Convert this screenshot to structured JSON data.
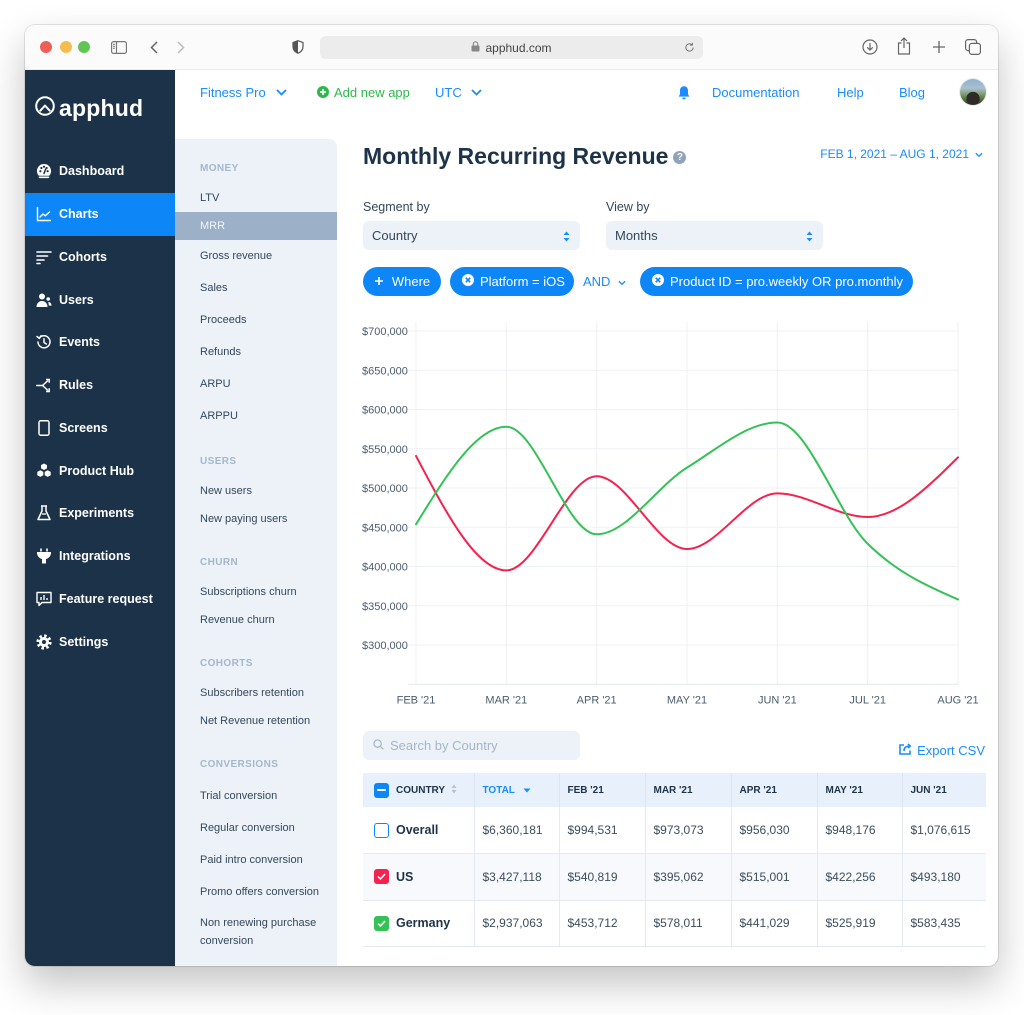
{
  "browser": {
    "url": "apphud.com"
  },
  "brand": {
    "name": "apphud"
  },
  "colors": {
    "accent": "#0d87f8",
    "link": "#1a8cff",
    "sidebar_bg": "#1c3249",
    "add_app": "#2db84c",
    "us": "#f5224f",
    "germany": "#34c156"
  },
  "sidebar": {
    "items": [
      {
        "label": "Dashboard",
        "icon": "dashboard-icon"
      },
      {
        "label": "Charts",
        "icon": "charts-icon",
        "active": true
      },
      {
        "label": "Cohorts",
        "icon": "cohorts-icon"
      },
      {
        "label": "Users",
        "icon": "users-icon"
      },
      {
        "label": "Events",
        "icon": "events-icon"
      },
      {
        "label": "Rules",
        "icon": "rules-icon"
      },
      {
        "label": "Screens",
        "icon": "screens-icon"
      },
      {
        "label": "Product Hub",
        "icon": "product-hub-icon"
      },
      {
        "label": "Experiments",
        "icon": "experiments-icon"
      },
      {
        "label": "Integrations",
        "icon": "integrations-icon"
      },
      {
        "label": "Feature request",
        "icon": "feature-request-icon"
      },
      {
        "label": "Settings",
        "icon": "settings-icon"
      }
    ]
  },
  "topnav": {
    "app_name": "Fitness Pro",
    "add_app_label": "Add new app",
    "timezone": "UTC",
    "links": {
      "documentation": "Documentation",
      "help": "Help",
      "blog": "Blog"
    }
  },
  "submenu": {
    "sections": [
      {
        "title": "MONEY",
        "items": [
          {
            "label": "LTV"
          },
          {
            "label": "MRR",
            "active": true
          },
          {
            "label": "Gross revenue"
          },
          {
            "label": "Sales"
          },
          {
            "label": "Proceeds"
          },
          {
            "label": "Refunds"
          },
          {
            "label": "ARPU"
          },
          {
            "label": "ARPPU"
          }
        ]
      },
      {
        "title": "USERS",
        "items": [
          {
            "label": "New users"
          },
          {
            "label": "New paying users"
          }
        ]
      },
      {
        "title": "CHURN",
        "items": [
          {
            "label": "Subscriptions churn"
          },
          {
            "label": "Revenue churn"
          }
        ]
      },
      {
        "title": "COHORTS",
        "items": [
          {
            "label": "Subscribers retention"
          },
          {
            "label": "Net Revenue retention"
          }
        ]
      },
      {
        "title": "CONVERSIONS",
        "items": [
          {
            "label": "Trial conversion"
          },
          {
            "label": "Regular conversion"
          },
          {
            "label": "Paid intro conversion"
          },
          {
            "label": "Promo offers conversion"
          },
          {
            "label": "Non renewing purchase conversion"
          }
        ]
      }
    ]
  },
  "page": {
    "title": "Monthly Recurring Revenue",
    "help_glyph": "?",
    "date_range": "FEB 1, 2021 – AUG 1, 2021"
  },
  "controls": {
    "segment_label": "Segment by",
    "segment_value": "Country",
    "view_label": "View by",
    "view_value": "Months"
  },
  "filters": {
    "add_label": "Where",
    "chips": [
      "Platform = iOS",
      "Product ID = pro.weekly OR pro.monthly"
    ],
    "operator": "AND"
  },
  "table": {
    "search_placeholder": "Search by Country",
    "export_label": "Export CSV",
    "header_checkbox": "indeterminate",
    "columns": [
      {
        "label": "COUNTRY",
        "sort": "none"
      },
      {
        "label": "TOTAL",
        "sort": "desc",
        "active": true
      },
      {
        "label": "FEB '21"
      },
      {
        "label": "MAR '21"
      },
      {
        "label": "APR '21"
      },
      {
        "label": "MAY '21"
      },
      {
        "label": "JUN '21"
      }
    ],
    "rows": [
      {
        "name": "Overall",
        "checked": false,
        "color": "#0d87f8",
        "values": [
          "$6,360,181",
          "$994,531",
          "$973,073",
          "$956,030",
          "$948,176",
          "$1,076,615"
        ]
      },
      {
        "name": "US",
        "checked": true,
        "color": "#f5224f",
        "values": [
          "$3,427,118",
          "$540,819",
          "$395,062",
          "$515,001",
          "$422,256",
          "$493,180"
        ]
      },
      {
        "name": "Germany",
        "checked": true,
        "color": "#34c156",
        "values": [
          "$2,937,063",
          "$453,712",
          "$578,011",
          "$441,029",
          "$525,919",
          "$583,435"
        ]
      }
    ]
  },
  "chart_data": {
    "type": "line",
    "title": "Monthly Recurring Revenue",
    "xlabel": "",
    "ylabel": "",
    "categories": [
      "FEB '21",
      "MAR '21",
      "APR '21",
      "MAY '21",
      "JUN '21",
      "JUL '21",
      "AUG '21"
    ],
    "series": [
      {
        "name": "US",
        "color": "#f5224f",
        "values": [
          540819,
          395062,
          515001,
          422256,
          493180,
          463000,
          539000
        ]
      },
      {
        "name": "Germany",
        "color": "#34c156",
        "values": [
          453712,
          578011,
          441029,
          525919,
          583435,
          429000,
          358000
        ]
      }
    ],
    "y_ticks": [
      300000,
      350000,
      400000,
      450000,
      500000,
      550000,
      600000,
      650000,
      700000
    ],
    "y_tick_labels": [
      "$300,000",
      "$350,000",
      "$400,000",
      "$450,000",
      "$500,000",
      "$550,000",
      "$600,000",
      "$650,000",
      "$700,000"
    ],
    "ylim": [
      250000,
      700000
    ],
    "grid": true,
    "legend": "none"
  }
}
